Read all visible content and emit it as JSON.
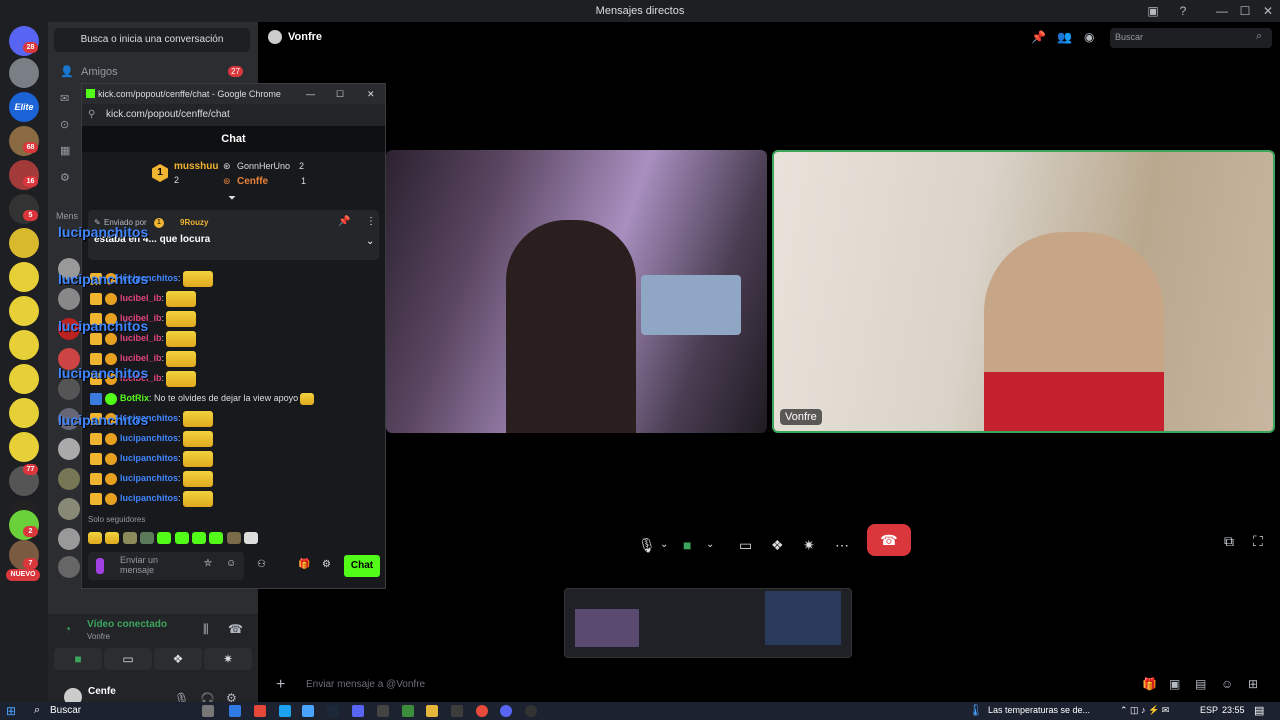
{
  "window": {
    "title": "Mensajes directos",
    "controls": [
      "—",
      "☐",
      "✕"
    ]
  },
  "rail": {
    "badges": [
      "28",
      "68",
      "16",
      "5",
      "77",
      "1",
      "2",
      "7"
    ],
    "new_label": "NUEVO",
    "elite_label": "Elite"
  },
  "sidebar": {
    "search_label": "Busca o inicia una conversación",
    "friends_label": "Amigos",
    "friends_badge": "27",
    "messages_label": "Mens",
    "voice_status": "Vídeo conectado",
    "voice_channel": "Vonfre",
    "user_name": "Cenfe"
  },
  "header": {
    "channel_name": "Vonfre",
    "search_placeholder": "Buscar"
  },
  "call": {
    "tile2_name": "Vonfre"
  },
  "composer": {
    "placeholder": "Enviar mensaje a @Vonfre"
  },
  "popup": {
    "title": "kick.com/popout/cenffe/chat - Google Chrome",
    "url": "kick.com/popout/cenffe/chat",
    "chat_header": "Chat",
    "leaderboard": {
      "first_rank": "1",
      "first_name": "musshuu",
      "first_count": "2",
      "second_name": "GonnHerUno",
      "second_count": "2",
      "third_name": "Cenffe",
      "third_count": "1"
    },
    "pinned": {
      "sent_by": "Enviado por",
      "sender_badge": "1",
      "sender": "9Rouzy",
      "text": "estaba en 4... que locura"
    },
    "overlay_name": "lucipanchitos",
    "messages": [
      {
        "user": "lucipanchitos",
        "color": "#3f86ff",
        "text": ":"
      },
      {
        "user": "lucibel_ib",
        "color": "#e0457b",
        "text": ":"
      },
      {
        "user": "lucibel_ib",
        "color": "#e0457b",
        "text": ":"
      },
      {
        "user": "lucibel_ib",
        "color": "#e0457b",
        "text": ":"
      },
      {
        "user": "lucibel_ib",
        "color": "#e0457b",
        "text": ":"
      },
      {
        "user": "lucibel_ib",
        "color": "#e0457b",
        "text": ":"
      },
      {
        "user": "BotRix",
        "color": "#53fc18",
        "text": ": No te olvides de dejar la view apoyo"
      },
      {
        "user": "lucipanchitos",
        "color": "#3f86ff",
        "text": ":"
      },
      {
        "user": "lucipanchitos",
        "color": "#3f86ff",
        "text": ":"
      },
      {
        "user": "lucipanchitos",
        "color": "#3f86ff",
        "text": ":"
      },
      {
        "user": "lucipanchitos",
        "color": "#3f86ff",
        "text": ":"
      },
      {
        "user": "lucipanchitos",
        "color": "#3f86ff",
        "text": ":"
      }
    ],
    "followers_only": "Solo seguidores",
    "input_placeholder": "Enviar un mensaje",
    "chat_button": "Chat"
  },
  "taskbar": {
    "search": "Buscar",
    "weather": "Las temperaturas se de...",
    "lang": "ESP",
    "time": "23:55"
  },
  "colors": {
    "accent_green": "#3ba55c",
    "danger": "#da373c",
    "kick_green": "#53fc18"
  }
}
